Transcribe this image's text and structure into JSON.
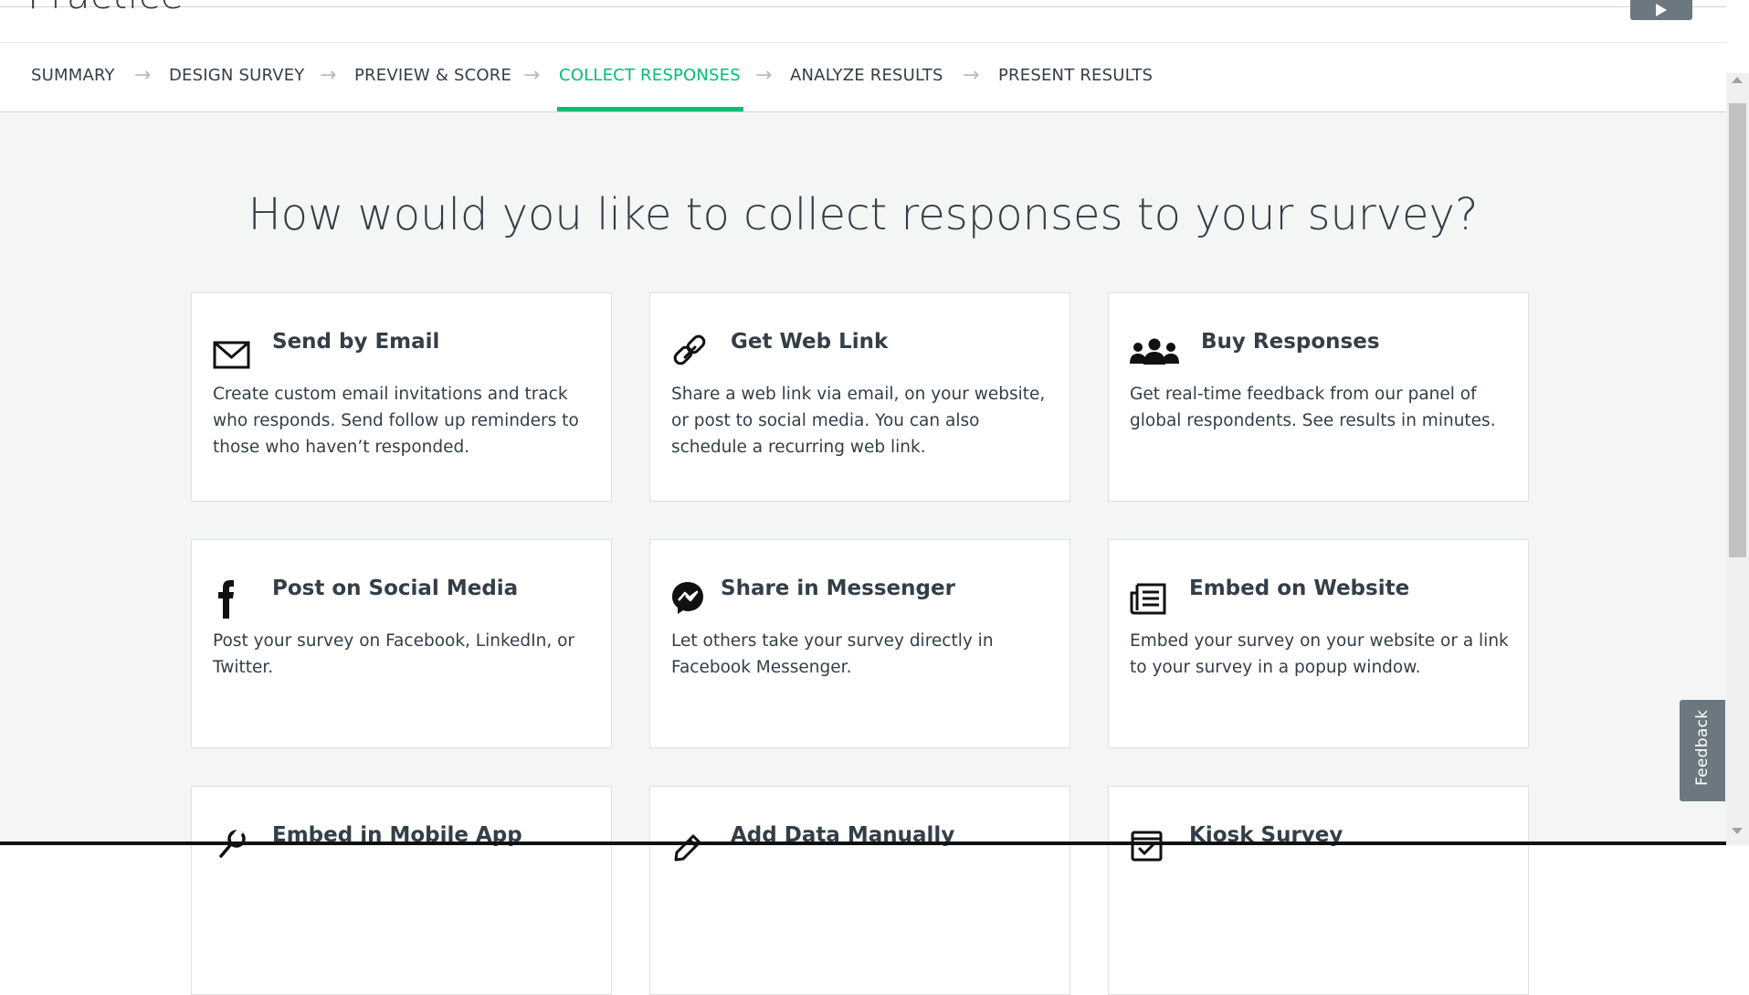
{
  "header": {
    "survey_title": "Practice"
  },
  "steps": [
    {
      "label": "SUMMARY",
      "active": false
    },
    {
      "label": "DESIGN SURVEY",
      "active": false
    },
    {
      "label": "PREVIEW & SCORE",
      "active": false
    },
    {
      "label": "COLLECT RESPONSES",
      "active": true
    },
    {
      "label": "ANALYZE RESULTS",
      "active": false
    },
    {
      "label": "PRESENT RESULTS",
      "active": false
    }
  ],
  "step_separator": "→",
  "main": {
    "heading": "How would you like to collect responses to your survey?"
  },
  "cards": [
    {
      "title": "Send by Email",
      "icon": "envelope-icon",
      "description": "Create custom email invitations and track who responds. Send follow up reminders to those who haven’t responded."
    },
    {
      "title": "Get Web Link",
      "icon": "link-icon",
      "description": "Share a web link via email, on your website, or post to social media. You can also schedule a recurring web link."
    },
    {
      "title": "Buy Responses",
      "icon": "people-icon",
      "description": "Get real-time feedback from our panel of global respondents. See results in minutes."
    },
    {
      "title": "Post on Social Media",
      "icon": "facebook-icon",
      "description": "Post your survey on Facebook, LinkedIn, or Twitter."
    },
    {
      "title": "Share in Messenger",
      "icon": "messenger-icon",
      "description": "Let others take your survey directly in Facebook Messenger."
    },
    {
      "title": "Embed on Website",
      "icon": "newspaper-icon",
      "description": "Embed your survey on your website or a link to your survey in a popup window."
    },
    {
      "title": "Embed in Mobile App",
      "icon": "wrench-icon",
      "description": ""
    },
    {
      "title": "Add Data Manually",
      "icon": "pencil-icon",
      "description": ""
    },
    {
      "title": "Kiosk Survey",
      "icon": "kiosk-icon",
      "description": ""
    }
  ],
  "feedback": {
    "label": "Feedback"
  },
  "colors": {
    "accent": "#00bf6f",
    "text": "#333e48",
    "background": "#f4f5f5",
    "tab": "#6b787f"
  }
}
